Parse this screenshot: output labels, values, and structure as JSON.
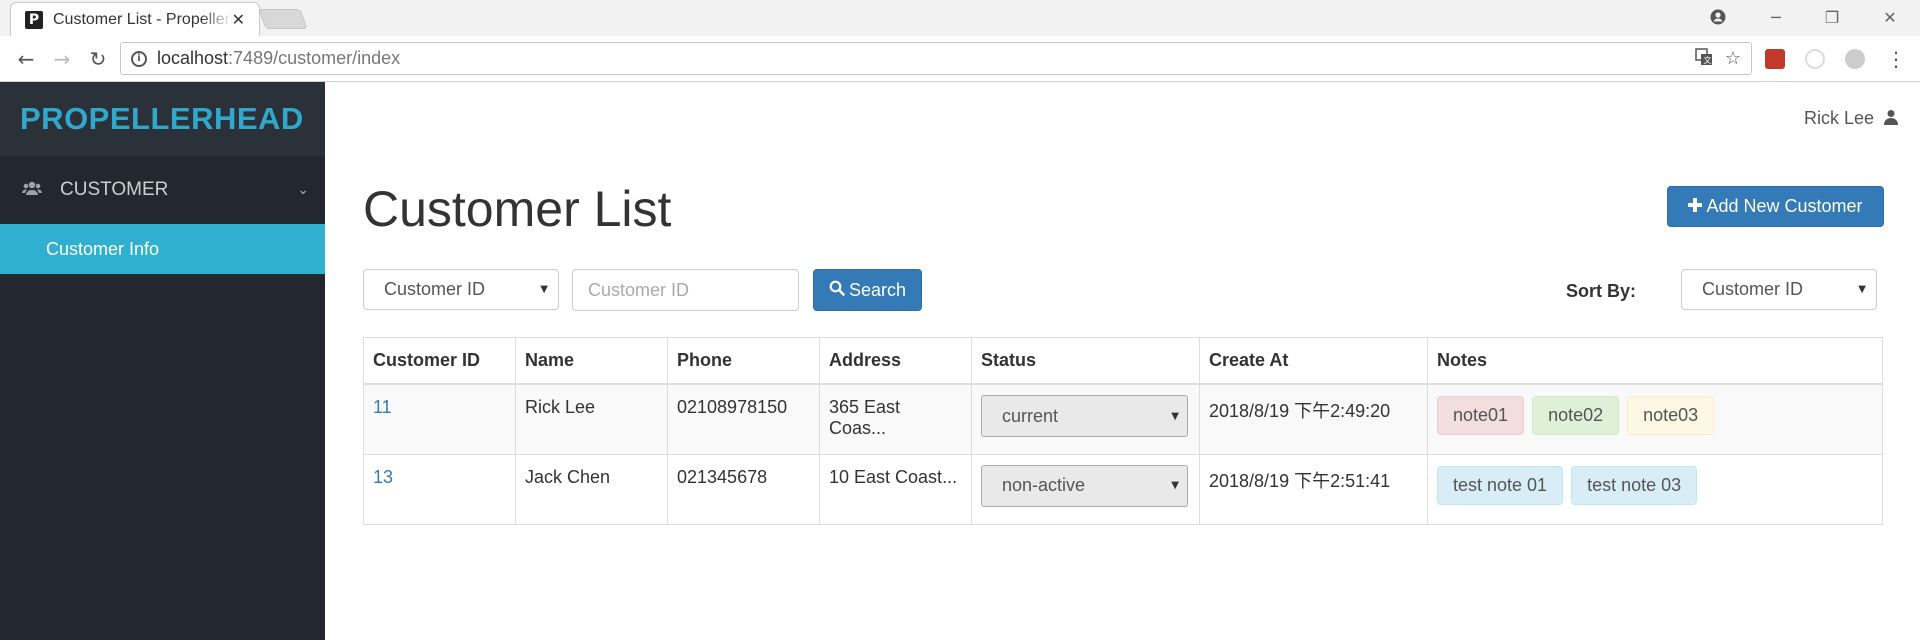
{
  "browser": {
    "tab_title": "Customer List - Propellerhead",
    "tab_close": "✕",
    "url_host": "localhost",
    "url_rest": ":7489/customer/index",
    "window_buttons": [
      "─",
      "❐",
      "✕"
    ]
  },
  "sidebar": {
    "brand": "PROPELLERHEAD",
    "group_label": "CUSTOMER",
    "items": [
      {
        "label": "Customer Info",
        "active": true
      }
    ]
  },
  "header": {
    "user_name": "Rick Lee"
  },
  "main": {
    "title": "Customer List",
    "add_button": "Add New Customer",
    "filter": {
      "field_select": "Customer ID",
      "search_placeholder": "Customer ID",
      "search_button": "Search"
    },
    "sort": {
      "label": "Sort By:",
      "value": "Customer ID"
    },
    "table": {
      "columns": [
        "Customer ID",
        "Name",
        "Phone",
        "Address",
        "Status",
        "Create At",
        "Notes"
      ],
      "rows": [
        {
          "id": "11",
          "name": "Rick Lee",
          "phone": "02108978150",
          "address": "365 East Coas...",
          "status": "current",
          "created": "2018/8/19 下午2:49:20",
          "notes": [
            {
              "text": "note01",
              "color": "red"
            },
            {
              "text": "note02",
              "color": "green"
            },
            {
              "text": "note03",
              "color": "yellow"
            }
          ]
        },
        {
          "id": "13",
          "name": "Jack Chen",
          "phone": "021345678",
          "address": "10 East Coast...",
          "status": "non-active",
          "created": "2018/8/19 下午2:51:41",
          "notes": [
            {
              "text": "test note 01",
              "color": "blue"
            },
            {
              "text": "test note 03",
              "color": "blue"
            }
          ]
        }
      ]
    }
  },
  "colors": {
    "brand": "#2fa8cc",
    "sidebar_bg": "#232830",
    "active_item": "#2fb0d0",
    "primary": "#337ab7"
  }
}
